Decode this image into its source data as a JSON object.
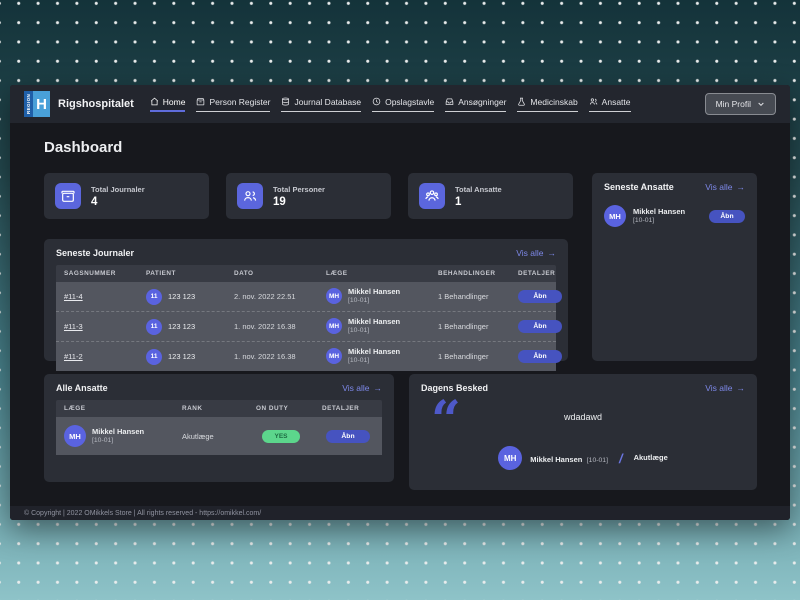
{
  "header": {
    "logo_region": "REGION",
    "logo_letter": "H",
    "brand": "Rigshospitalet",
    "nav": [
      {
        "label": "Home"
      },
      {
        "label": "Person Register"
      },
      {
        "label": "Journal Database"
      },
      {
        "label": "Opslagstavle"
      },
      {
        "label": "Ansøgninger"
      },
      {
        "label": "Medicinskab"
      },
      {
        "label": "Ansatte"
      }
    ],
    "profile_button": "Min Profil"
  },
  "page": {
    "title": "Dashboard"
  },
  "stats": [
    {
      "label": "Total Journaler",
      "value": "4"
    },
    {
      "label": "Total Personer",
      "value": "19"
    },
    {
      "label": "Total Ansatte",
      "value": "1"
    }
  ],
  "seneste_ansatte": {
    "title": "Seneste Ansatte",
    "view_all": "Vis alle",
    "items": [
      {
        "initials": "MH",
        "name": "Mikkel Hansen",
        "code": "[10-01]",
        "action": "Åbn"
      }
    ]
  },
  "seneste_journaler": {
    "title": "Seneste Journaler",
    "view_all": "Vis alle",
    "columns": [
      "Sagsnummer",
      "Patient",
      "Dato",
      "Læge",
      "Behandlinger",
      "Detaljer"
    ],
    "rows": [
      {
        "case_number": "#11-4",
        "patient_initials": "11",
        "patient": "123 123",
        "date": "2. nov. 2022 22.51",
        "doctor_initials": "MH",
        "doctor_name": "Mikkel Hansen",
        "doctor_code": "[10-01]",
        "treatments": "1 Behandlinger",
        "action": "Åbn"
      },
      {
        "case_number": "#11-3",
        "patient_initials": "11",
        "patient": "123 123",
        "date": "1. nov. 2022 16.38",
        "doctor_initials": "MH",
        "doctor_name": "Mikkel Hansen",
        "doctor_code": "[10-01]",
        "treatments": "1 Behandlinger",
        "action": "Åbn"
      },
      {
        "case_number": "#11-2",
        "patient_initials": "11",
        "patient": "123 123",
        "date": "1. nov. 2022 16.38",
        "doctor_initials": "MH",
        "doctor_name": "Mikkel Hansen",
        "doctor_code": "[10-01]",
        "treatments": "1 Behandlinger",
        "action": "Åbn"
      }
    ]
  },
  "alle_ansatte": {
    "title": "Alle Ansatte",
    "view_all": "Vis alle",
    "columns": [
      "Læge",
      "Rank",
      "On Duty",
      "Detaljer"
    ],
    "rows": [
      {
        "initials": "MH",
        "name": "Mikkel Hansen",
        "code": "[10-01]",
        "rank": "Akutlæge",
        "on_duty": "YES",
        "action": "Åbn"
      }
    ]
  },
  "dagens_besked": {
    "title": "Dagens Besked",
    "view_all": "Vis alle",
    "message": "wdadawd",
    "author_initials": "MH",
    "author_name": "Mikkel Hansen",
    "author_code": "[10-01]",
    "author_rank": "Akutlæge"
  },
  "footer": {
    "text": "© Copyright | 2022 OMikkels Store | All rights reserved - https://omikkel.com/"
  },
  "icons": {
    "arrow_right": "→",
    "quote": "“",
    "slash": "/"
  },
  "colors": {
    "accent": "#5b66dd",
    "button": "#4653c0",
    "green_pill": "#5cd68c",
    "link": "#7d88e8",
    "logo_blue": "#49a0d8"
  }
}
